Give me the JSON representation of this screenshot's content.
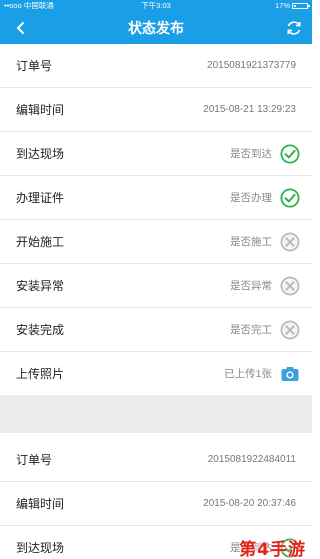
{
  "status_bar": {
    "carrier": "••ooo 中国联通",
    "time": "下午3:03",
    "battery": "17%"
  },
  "nav": {
    "title": "状态发布",
    "back_icon": "chevron-left-icon",
    "refresh_icon": "refresh-icon"
  },
  "orders": [
    {
      "order_label": "订单号",
      "order_no": "2015081921373779",
      "edit_label": "编辑时间",
      "edit_time": "2015-08-21 13:29:23",
      "steps": [
        {
          "label": "到达现场",
          "value": "是否到达",
          "state": "done"
        },
        {
          "label": "办理证件",
          "value": "是否办理",
          "state": "done"
        },
        {
          "label": "开始施工",
          "value": "是否施工",
          "state": "pending"
        },
        {
          "label": "安装异常",
          "value": "是否异常",
          "state": "pending"
        },
        {
          "label": "安装完成",
          "value": "是否完工",
          "state": "pending"
        }
      ],
      "photo_label": "上传照片",
      "photo_value": "已上传1张"
    },
    {
      "order_label": "订单号",
      "order_no": "2015081922484011",
      "edit_label": "编辑时间",
      "edit_time": "2015-08-20 20:37:46",
      "steps": [
        {
          "label": "到达现场",
          "value": "是否到达",
          "state": "done"
        }
      ]
    }
  ],
  "watermark": "第4手游",
  "colors": {
    "header": "#1a9ee6",
    "done_green": "#2bb24c",
    "pending_gray": "#b5b5b5",
    "camera_blue": "#3aa0e0"
  }
}
